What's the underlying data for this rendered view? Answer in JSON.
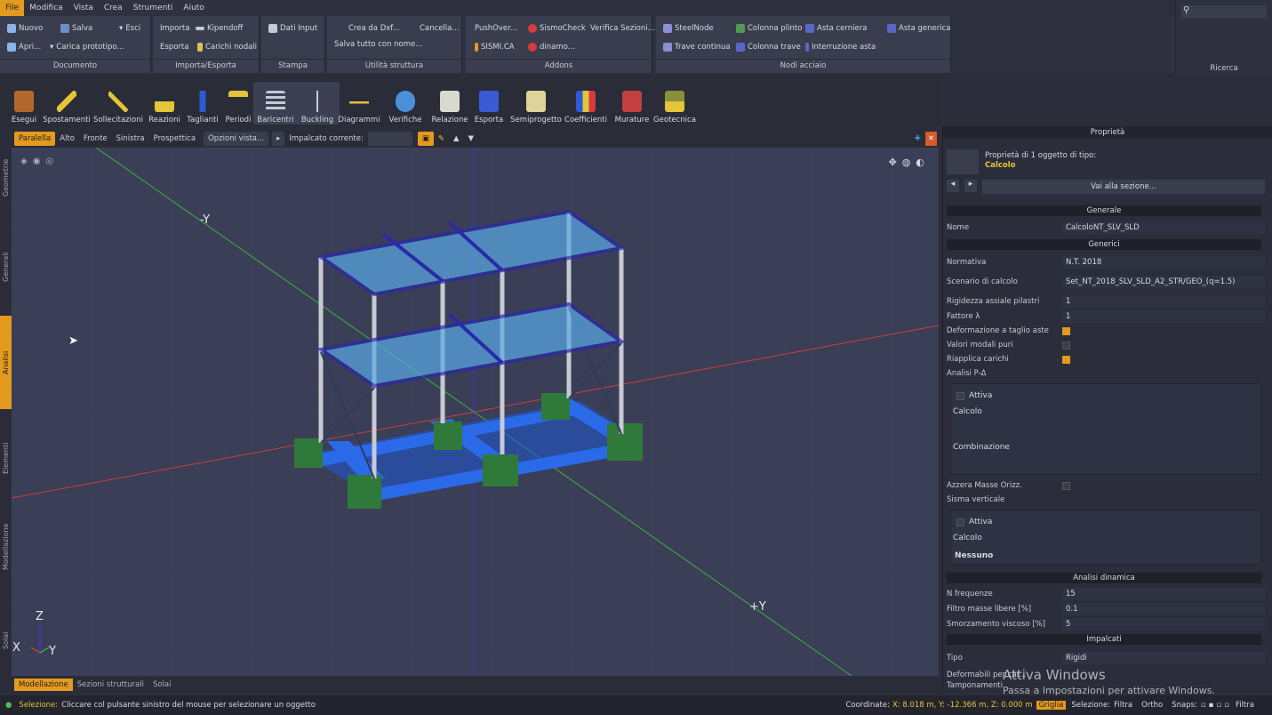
{
  "menu": [
    "File",
    "Modifica",
    "Vista",
    "Crea",
    "Strumenti",
    "Aiuto"
  ],
  "ribbon": {
    "documento": {
      "label": "Documento",
      "nuovo": "Nuovo",
      "salva": "Salva",
      "esci": "Esci",
      "apri": "Apri...",
      "carica_prototipo": "Carica prototipo..."
    },
    "importa_esporta": {
      "label": "Importa/Esporta",
      "importa": "Importa",
      "kipendoff": "Kipendoff",
      "esporta": "Esporta",
      "carichi_nodali": "Carichi nodali"
    },
    "stampa": {
      "label": "Stampa",
      "dati_input": "Dati Input"
    },
    "utilita": {
      "label": "Utilità struttura",
      "crea_dxf": "Crea da Dxf...",
      "cancella": "Cancella...",
      "salva_tutto": "Salva tutto con nome..."
    },
    "addons": {
      "label": "Addons",
      "pushover": "PushOver...",
      "sismocheck": "SismoCheck",
      "verifica_sezioni": "Verifica Sezioni...",
      "sismica": "SISMI.CA",
      "dinamo": "dinamo..."
    },
    "nodi_acciaio": {
      "label": "Nodi acciaio",
      "steelnode": "SteelNode",
      "colonna_plinto": "Colonna plinto",
      "asta_cerniera": "Asta cerniera",
      "asta_generica": "Asta generica",
      "trave_continua": "Trave continua",
      "colonna_trave": "Colonna trave",
      "interruzione_asta": "Interruzione asta"
    }
  },
  "search": {
    "label": "Ricerca"
  },
  "tools": [
    "Esegui",
    "Spostamenti",
    "Sollecitazioni",
    "Reazioni",
    "Taglianti",
    "Periodi",
    "Baricentri",
    "Buckling",
    "Diagrammi",
    "Verifiche",
    "Relazione",
    "Esporta",
    "Semiprogetto",
    "Coefficienti",
    "Murature",
    "Geotecnica"
  ],
  "view_toolbar": {
    "views": [
      "Paralella",
      "Alto",
      "Fronte",
      "Sinistra",
      "Prospettica"
    ],
    "opzioni": "Opzioni vista...",
    "impalcato": "Impalcato corrente:"
  },
  "vertical_tabs": [
    "Geometrie",
    "Generali",
    "Analisi",
    "Elementi",
    "Modellazione",
    "Solai"
  ],
  "viewport": {
    "axis_neg_y": "-Y",
    "axis_pos_y": "+Y",
    "triad_z": "Z",
    "triad_x": "X",
    "triad_y": "Y"
  },
  "bottom_tabs": [
    "Modellazione",
    "Sezioni strutturali",
    "Solai"
  ],
  "status": {
    "selezione_label": "Selezione:",
    "selezione_text": "Cliccare col pulsante sinistro del mouse per selezionare un oggetto",
    "coordinate_label": "Coordinate:",
    "coordinate_value": "X: 8.018 m, Y: -12.366 m, Z: 0.000 m",
    "griglia": "Griglia",
    "selezione2": "Selezione:",
    "filtra": "Filtra",
    "ortho": "Ortho",
    "snaps": "Snaps:",
    "filtra2": "Filtra"
  },
  "props": {
    "title": "Proprietà",
    "header_line1": "Proprietà di 1 oggetto di tipo:",
    "header_type": "Calcolo",
    "vai_sezione": "Vai alla sezione...",
    "s_generale": "Generale",
    "nome_label": "Nome",
    "nome_value": "CalcoloNT_SLV_SLD",
    "s_generici": "Generici",
    "normativa_label": "Normativa",
    "normativa_value": "N.T. 2018",
    "scenario_label": "Scenario di calcolo",
    "scenario_value": "Set_NT_2018_SLV_SLD_A2_STR/GEO_(q=1.5)",
    "rigidezza_label": "Rigidezza assiale pilastri",
    "rigidezza_value": "1",
    "fattore_label": "Fattore λ",
    "fattore_value": "1",
    "deformazione_label": "Deformazione a taglio aste",
    "valori_label": "Valori modali puri",
    "riapplica_label": "Riapplica carichi",
    "pdelta_label": "Analisi P-Δ",
    "attiva": "Attiva",
    "calcolo": "Calcolo",
    "combinazione": "Combinazione",
    "azzera_label": "Azzera Masse Orizz.",
    "sisma_label": "Sisma verticale",
    "nessuno": "Nessuno",
    "s_dinamica": "Analisi dinamica",
    "nfreq_label": "N frequenze",
    "nfreq_value": "15",
    "filtro_label": "Filtro masse libere [%]",
    "filtro_value": "0.1",
    "smorz_label": "Smorzamento viscoso [%]",
    "smorz_value": "5",
    "s_impalcati": "Impalcati",
    "tipo_label": "Tipo",
    "tipo_value": "Rigidi",
    "deformabili_label": "Deformabili per car...",
    "tamponamenti_label": "Tamponamenti"
  },
  "watermark": {
    "line1": "Attiva Windows",
    "line2": "Passa a Impostazioni per attivare Windows."
  },
  "colors": {
    "accent": "#e39a1e",
    "beam": "#2a2aa8",
    "slab": "#5aa9e6",
    "foundation": "#1f55d6",
    "plinth": "#2f7a3a"
  }
}
